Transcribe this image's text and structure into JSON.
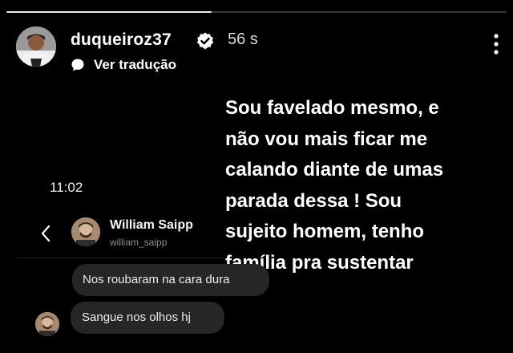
{
  "story": {
    "progress_fraction": 0.41,
    "username": "duqueiroz37",
    "time_ago": "56 s",
    "translate_label": "Ver tradução",
    "text_lines": [
      "Sou favelado mesmo, e",
      "não vou mais ficar me",
      "calando diante de umas",
      "parada dessa ! Sou",
      "sujeito homem, tenho",
      "família pra sustentar"
    ]
  },
  "dm": {
    "status_time": "11:02",
    "contact_name": "William Saipp",
    "contact_handle": "william_saipp",
    "messages": [
      "Nos roubaram na cara dura",
      "Sangue nos olhos hj"
    ]
  },
  "icons": {
    "verified": "verified-badge-icon",
    "more": "more-vertical-icon",
    "translate": "speech-bubble-icon",
    "back": "chevron-left-icon"
  },
  "colors": {
    "background": "#000000",
    "bubble": "#262626",
    "muted_text": "#8e8e8e"
  }
}
